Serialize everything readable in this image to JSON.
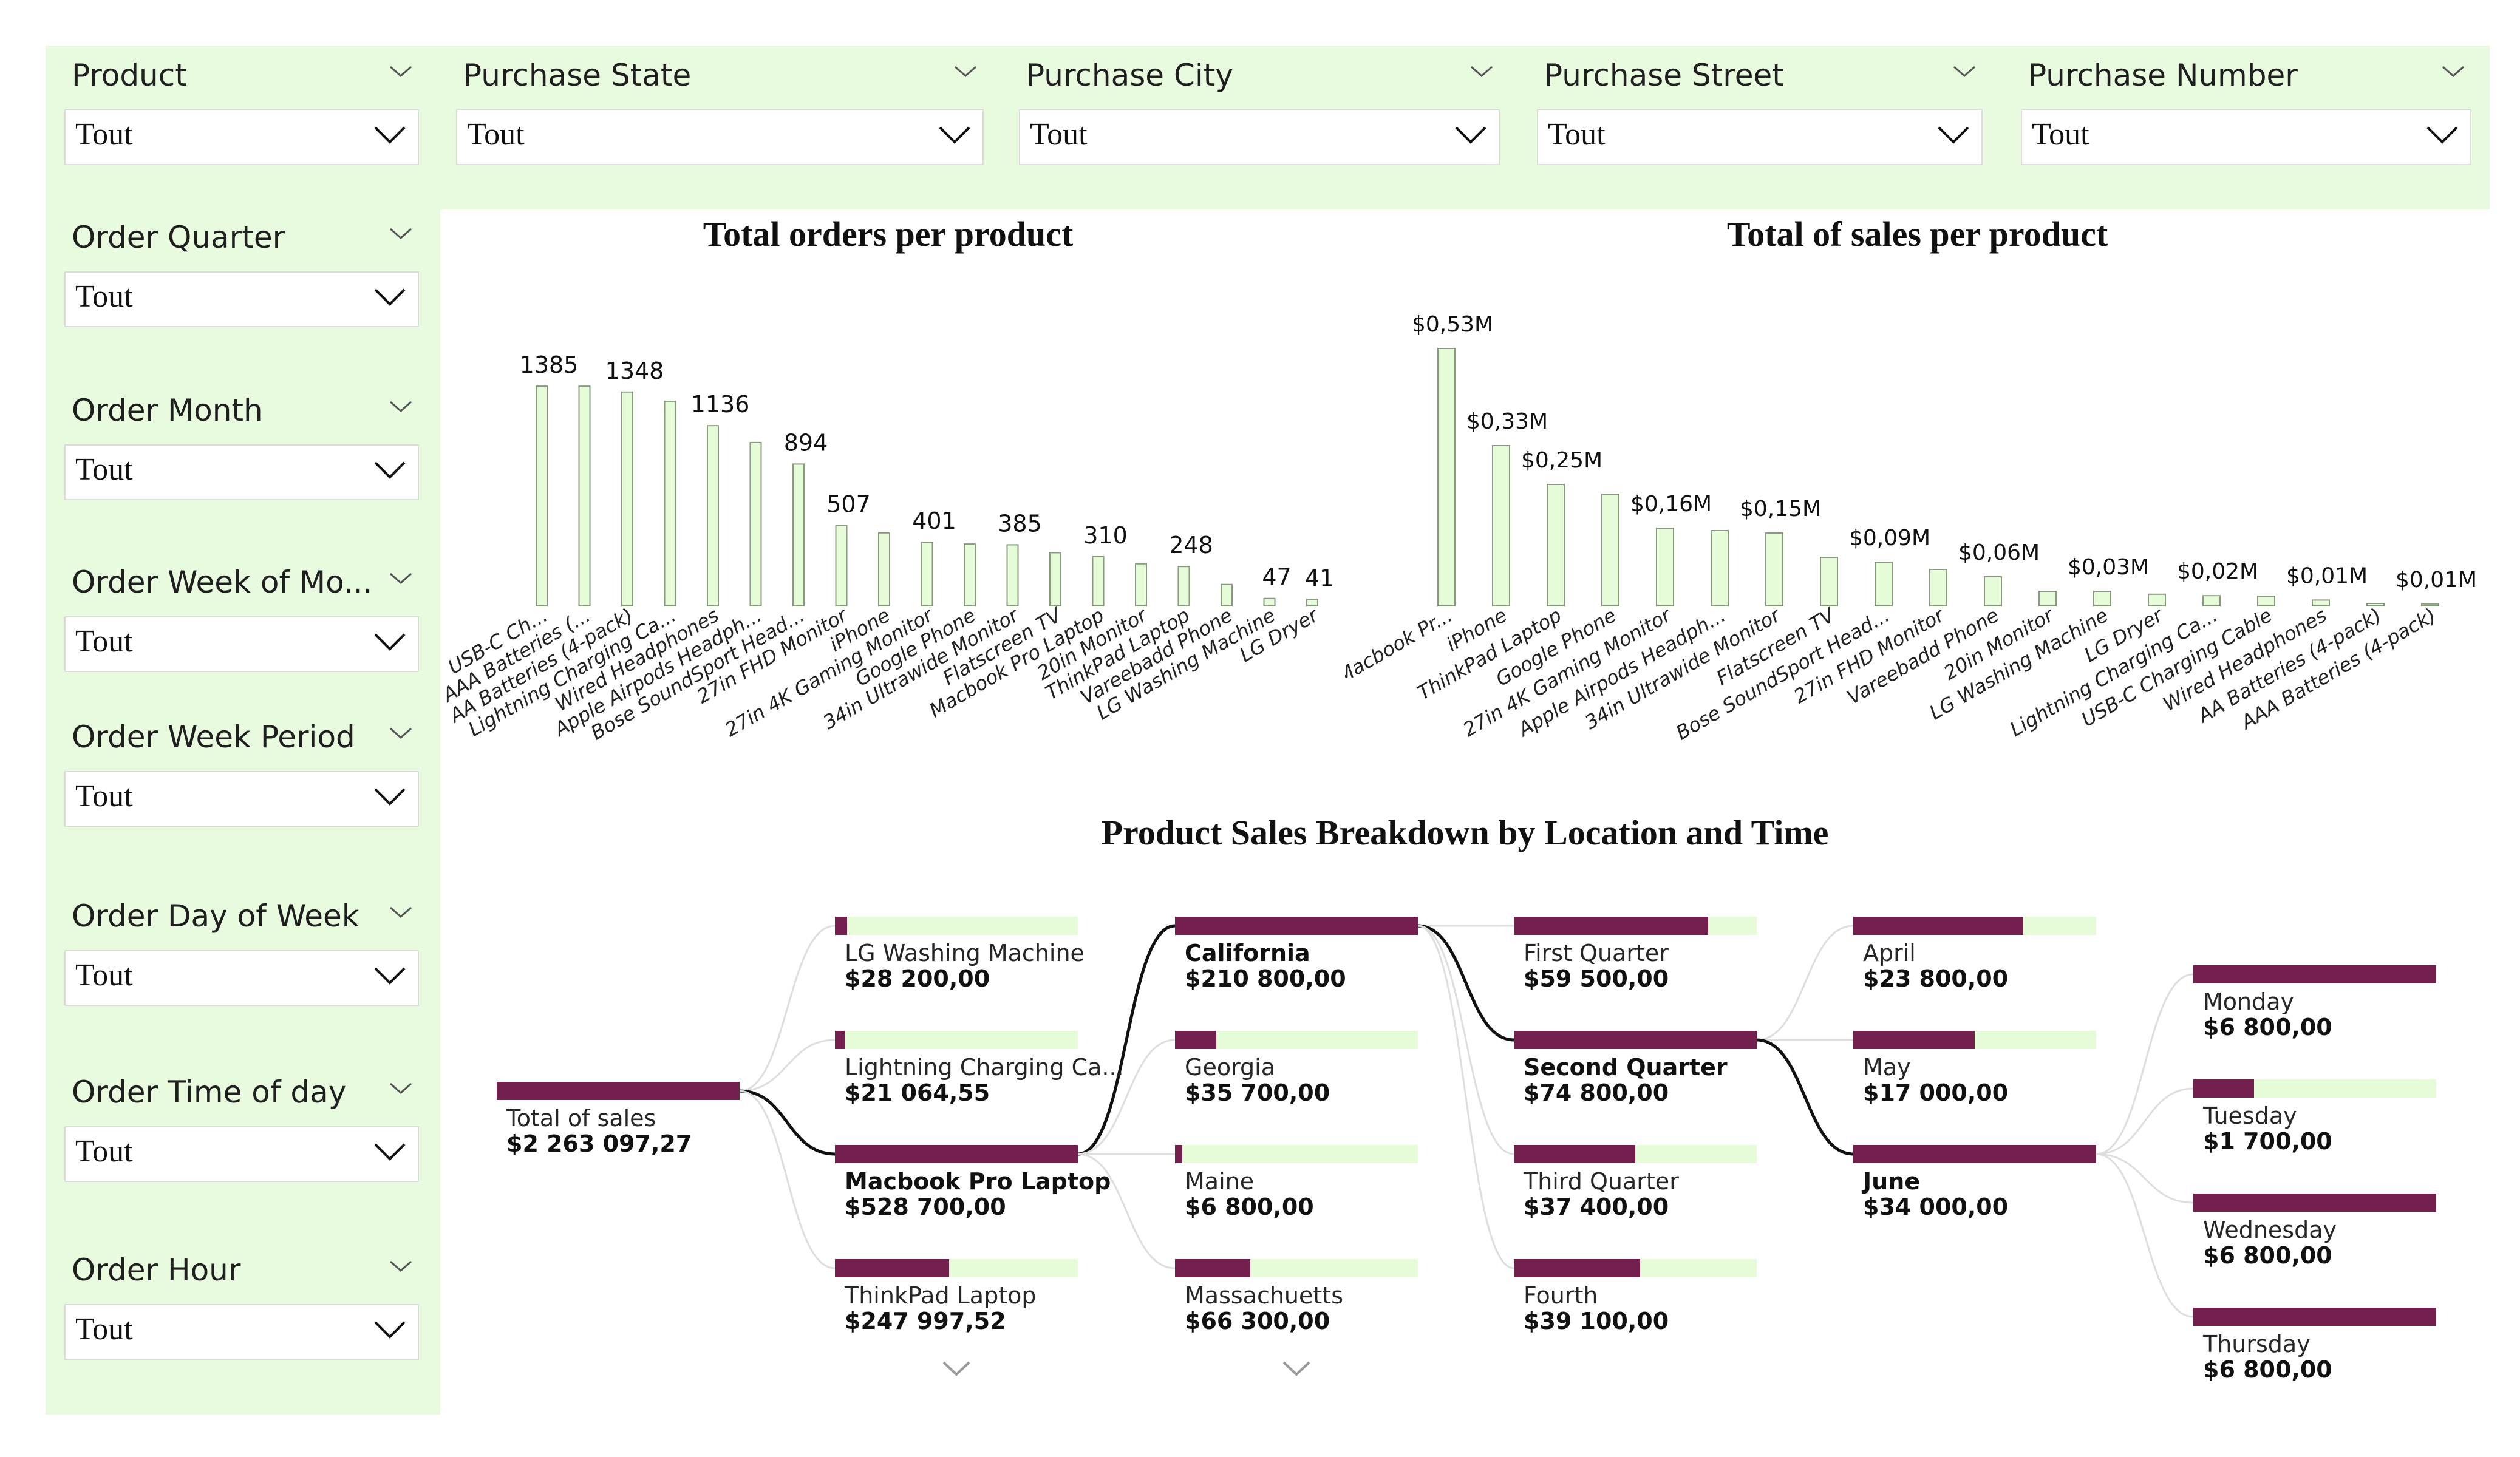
{
  "slicers": [
    {
      "title": "Product",
      "value": "Tout"
    },
    {
      "title": "Purchase State",
      "value": "Tout"
    },
    {
      "title": "Purchase City",
      "value": "Tout"
    },
    {
      "title": "Purchase Street",
      "value": "Tout"
    },
    {
      "title": "Purchase Number",
      "value": "Tout"
    },
    {
      "title": "Order Quarter",
      "value": "Tout"
    },
    {
      "title": "Order Month",
      "value": "Tout"
    },
    {
      "title": "Order Week of Mo...",
      "value": "Tout"
    },
    {
      "title": "Order Week Period",
      "value": "Tout"
    },
    {
      "title": "Order Day of Week",
      "value": "Tout"
    },
    {
      "title": "Order Time of day",
      "value": "Tout"
    },
    {
      "title": "Order Hour",
      "value": "Tout"
    }
  ],
  "colors": {
    "panel": "#e9fbdf",
    "bar_fill": "#e6fcd9",
    "bar_stroke": "#8a9a80",
    "tree_bar": "#74204f",
    "tree_bg": "#e6fcd9"
  },
  "chart_data": [
    {
      "type": "bar",
      "title": "Total orders per product",
      "categories": [
        "USB-C Ch...",
        "AAA Batteries (...",
        "AA Batteries (4-pack)",
        "Lightning Charging Ca...",
        "Wired Headphones",
        "Apple Airpods Headph...",
        "Bose SoundSport Head...",
        "27in FHD Monitor",
        "iPhone",
        "27in 4K Gaming Monitor",
        "Google Phone",
        "34in Ultrawide Monitor",
        "Flatscreen TV",
        "Macbook Pro Laptop",
        "20in Monitor",
        "ThinkPad Laptop",
        "Vareebadd Phone",
        "LG Washing Machine",
        "LG Dryer"
      ],
      "values": [
        1385,
        1385,
        1348,
        1290,
        1136,
        1030,
        894,
        507,
        460,
        401,
        390,
        385,
        335,
        310,
        265,
        248,
        135,
        47,
        41
      ],
      "data_labels": [
        "1385",
        "",
        "1348",
        "",
        "1136",
        "",
        "894",
        "507",
        "",
        "401",
        "",
        "385",
        "",
        "310",
        "",
        "248",
        "",
        "47",
        "41"
      ],
      "ylim": [
        0,
        1500
      ]
    },
    {
      "type": "bar",
      "title": "Total of sales per product",
      "categories": [
        "Macbook Pr...",
        "iPhone",
        "ThinkPad Laptop",
        "Google Phone",
        "27in 4K Gaming Monitor",
        "Apple Airpods Headph...",
        "34in Ultrawide Monitor",
        "Flatscreen TV",
        "Bose SoundSport Head...",
        "27in FHD Monitor",
        "Vareebadd Phone",
        "20in Monitor",
        "LG Washing Machine",
        "LG Dryer",
        "Lightning Charging Ca...",
        "USB-C Charging Cable",
        "Wired Headphones",
        "AA Batteries (4-pack)",
        "AAA Batteries (4-pack)"
      ],
      "values": [
        0.53,
        0.33,
        0.25,
        0.23,
        0.16,
        0.155,
        0.15,
        0.1,
        0.09,
        0.075,
        0.06,
        0.03,
        0.03,
        0.024,
        0.021,
        0.02,
        0.012,
        0.005,
        0.004
      ],
      "data_labels": [
        "$0,53M",
        "$0,33M",
        "$0,25M",
        "",
        "$0,16M",
        "",
        "$0,15M",
        "",
        "$0,09M",
        "",
        "$0,06M",
        "",
        "$0,03M",
        "",
        "$0,02M",
        "",
        "$0,01M",
        "",
        "$0,01M"
      ],
      "ylim": [
        0,
        0.6
      ]
    }
  ],
  "tree": {
    "title": "Product Sales Breakdown by Location and Time",
    "root": {
      "label": "Total of sales",
      "value": "$2 263 097,27",
      "frac": 1.0
    },
    "levels": [
      [
        {
          "label": "LG Washing Machine",
          "value": "$28 200,00",
          "frac": 0.05
        },
        {
          "label": "Lightning Charging Ca...",
          "value": "$21 064,55",
          "frac": 0.04
        },
        {
          "label": "Macbook Pro Laptop",
          "value": "$528 700,00",
          "frac": 1.0,
          "selected": true
        },
        {
          "label": "ThinkPad Laptop",
          "value": "$247 997,52",
          "frac": 0.47
        }
      ],
      [
        {
          "label": "California",
          "value": "$210 800,00",
          "frac": 1.0,
          "selected": true
        },
        {
          "label": "Georgia",
          "value": "$35 700,00",
          "frac": 0.17
        },
        {
          "label": "Maine",
          "value": "$6 800,00",
          "frac": 0.03
        },
        {
          "label": "Massachuetts",
          "value": "$66 300,00",
          "frac": 0.31
        }
      ],
      [
        {
          "label": "First Quarter",
          "value": "$59 500,00",
          "frac": 0.8
        },
        {
          "label": "Second Quarter",
          "value": "$74 800,00",
          "frac": 1.0,
          "selected": true
        },
        {
          "label": "Third Quarter",
          "value": "$37 400,00",
          "frac": 0.5
        },
        {
          "label": "Fourth",
          "value": "$39 100,00",
          "frac": 0.52
        }
      ],
      [
        {
          "label": "April",
          "value": "$23 800,00",
          "frac": 0.7
        },
        {
          "label": "May",
          "value": "$17 000,00",
          "frac": 0.5
        },
        {
          "label": "June",
          "value": "$34 000,00",
          "frac": 1.0,
          "selected": true
        }
      ],
      [
        {
          "label": "Monday",
          "value": "$6 800,00",
          "frac": 1.0
        },
        {
          "label": "Tuesday",
          "value": "$1 700,00",
          "frac": 0.25
        },
        {
          "label": "Wednesday",
          "value": "$6 800,00",
          "frac": 1.0
        },
        {
          "label": "Thursday",
          "value": "$6 800,00",
          "frac": 1.0
        }
      ]
    ]
  }
}
